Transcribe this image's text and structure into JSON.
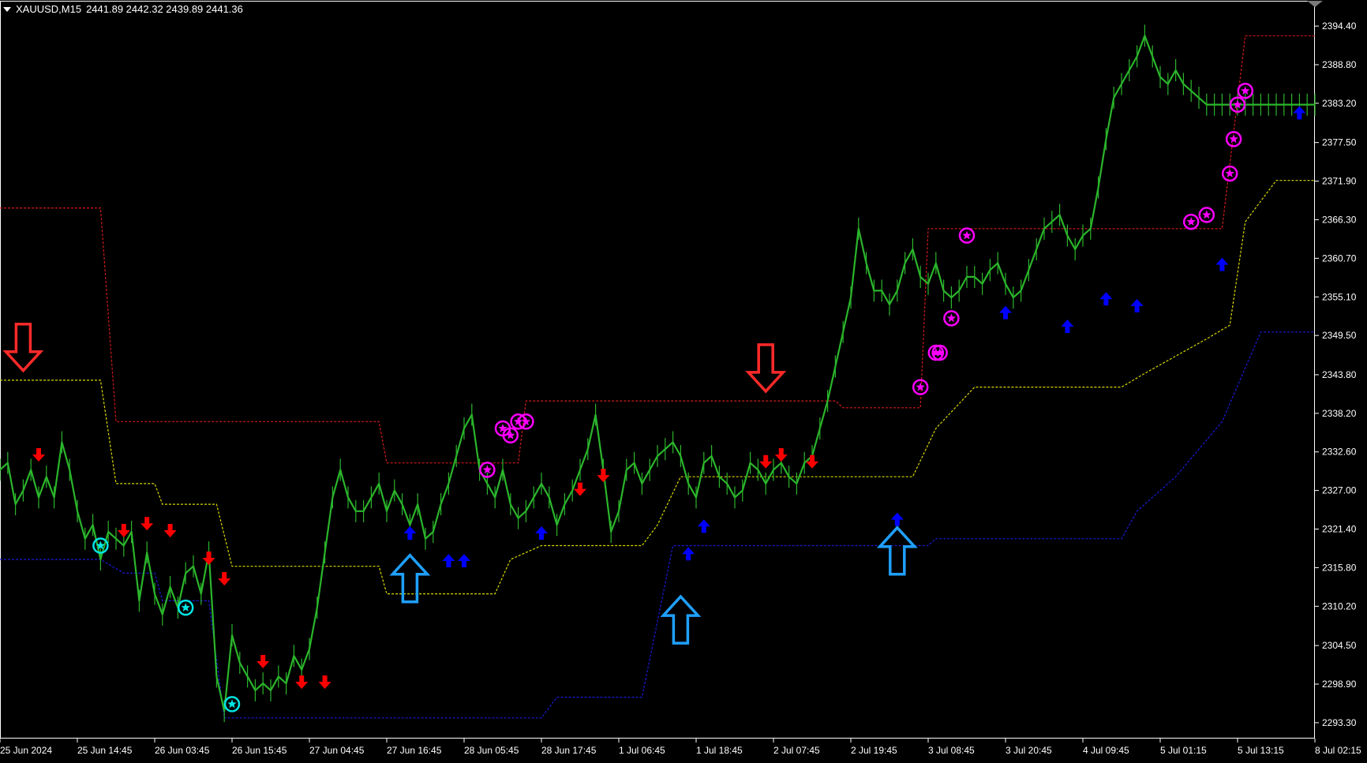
{
  "header": {
    "symbol": "XAUUSD,M15",
    "ohlc": "2441.89 2442.32 2439.89 2441.36"
  },
  "colors": {
    "background": "#000000",
    "price": "#2bb52b",
    "resistance": "#d21a1a",
    "middle": "#d8d800",
    "support": "#1a1ad8",
    "sell_arrow": "#ff0000",
    "buy_arrow": "#0000ff",
    "star_sell": "#ff00ff",
    "star_buy": "#00e5e5",
    "big_sell_outline": "#ff2a2a",
    "big_buy_outline": "#1fa0ff",
    "axis_text": "#ffffff",
    "frame": "#ffffff"
  },
  "chart_data": {
    "type": "line",
    "instrument": "XAUUSD",
    "timeframe": "M15",
    "ylim": [
      2291.0,
      2397.5
    ],
    "y_ticks": [
      2394.4,
      2388.8,
      2383.2,
      2377.5,
      2371.9,
      2366.3,
      2360.7,
      2355.1,
      2349.5,
      2343.8,
      2338.2,
      2332.6,
      2327.0,
      2321.4,
      2315.8,
      2310.2,
      2304.5,
      2298.9,
      2293.3
    ],
    "y_tick_labels": [
      "2394.40",
      "2388.80",
      "2383.20",
      "2377.50",
      "2371.90",
      "2366.30",
      "2360.70",
      "2355.10",
      "2349.50",
      "2343.80",
      "2338.20",
      "2332.60",
      "2327.00",
      "2321.40",
      "2315.80",
      "2310.20",
      "2304.50",
      "2298.90",
      "2293.30"
    ],
    "x_tick_labels": [
      "25 Jun 2024",
      "25 Jun 14:45",
      "26 Jun 03:45",
      "26 Jun 15:45",
      "27 Jun 04:45",
      "27 Jun 16:45",
      "28 Jun 05:45",
      "28 Jun 17:45",
      "1 Jul 06:45",
      "1 Jul 18:45",
      "2 Jul 07:45",
      "2 Jul 19:45",
      "3 Jul 08:45",
      "3 Jul 20:45",
      "4 Jul 09:45",
      "5 Jul 01:15",
      "5 Jul 13:15",
      "8 Jul 02:15"
    ],
    "xlim": [
      0,
      170
    ],
    "x_tick_positions": [
      0,
      10,
      20,
      30,
      40,
      50,
      60,
      70,
      80,
      90,
      100,
      110,
      120,
      130,
      140,
      150,
      160,
      170
    ],
    "price_series": {
      "x": [
        0,
        1,
        2,
        3,
        4,
        5,
        6,
        7,
        8,
        9,
        10,
        11,
        12,
        13,
        14,
        15,
        16,
        17,
        18,
        19,
        20,
        21,
        22,
        23,
        24,
        25,
        26,
        27,
        28,
        29,
        30,
        31,
        32,
        33,
        34,
        35,
        36,
        37,
        38,
        39,
        40,
        41,
        42,
        43,
        44,
        45,
        46,
        47,
        48,
        49,
        50,
        51,
        52,
        53,
        54,
        55,
        56,
        57,
        58,
        59,
        60,
        61,
        62,
        63,
        64,
        65,
        66,
        67,
        68,
        69,
        70,
        71,
        72,
        73,
        74,
        75,
        76,
        77,
        78,
        79,
        80,
        81,
        82,
        83,
        84,
        85,
        86,
        87,
        88,
        89,
        90,
        91,
        92,
        93,
        94,
        95,
        96,
        97,
        98,
        99,
        100,
        101,
        102,
        103,
        104,
        105,
        106,
        107,
        108,
        109,
        110,
        111,
        112,
        113,
        114,
        115,
        116,
        117,
        118,
        119,
        120,
        121,
        122,
        123,
        124,
        125,
        126,
        127,
        128,
        129,
        130,
        131,
        132,
        133,
        134,
        135,
        136,
        137,
        138,
        139,
        140,
        141,
        142,
        143,
        144,
        145,
        146,
        147,
        148,
        149,
        150,
        151,
        152,
        153,
        154,
        155,
        156,
        157,
        158,
        159,
        160,
        161,
        162,
        163,
        164,
        165,
        166,
        167,
        168,
        169,
        170
      ],
      "y": [
        2330,
        2331,
        2325,
        2327,
        2330,
        2326,
        2329,
        2326,
        2334,
        2330,
        2324,
        2320,
        2322,
        2317,
        2321,
        2320,
        2319,
        2321,
        2311,
        2318,
        2312,
        2309,
        2313,
        2310,
        2315,
        2316,
        2312,
        2318,
        2300,
        2295,
        2306,
        2302,
        2300,
        2298,
        2299,
        2298,
        2300,
        2299,
        2303,
        2301,
        2304,
        2310,
        2318,
        2326,
        2330,
        2326,
        2324,
        2324,
        2326,
        2328,
        2324,
        2327,
        2325,
        2322,
        2325,
        2320,
        2321,
        2325,
        2328,
        2332,
        2336,
        2338,
        2330,
        2328,
        2326,
        2330,
        2325,
        2323,
        2324,
        2326,
        2328,
        2326,
        2322,
        2325,
        2327,
        2330,
        2333,
        2338,
        2330,
        2321,
        2324,
        2330,
        2331,
        2328,
        2330,
        2332,
        2333,
        2334,
        2332,
        2328,
        2326,
        2331,
        2332,
        2329,
        2328,
        2326,
        2327,
        2331,
        2330,
        2328,
        2330,
        2331,
        2329,
        2328,
        2331,
        2332,
        2336,
        2340,
        2345,
        2350,
        2355,
        2365,
        2360,
        2356,
        2356,
        2354,
        2356,
        2360,
        2362,
        2358,
        2357,
        2360,
        2356,
        2355,
        2356,
        2358,
        2358,
        2357,
        2359,
        2360,
        2357,
        2355,
        2356,
        2359,
        2362,
        2365,
        2366,
        2367,
        2364,
        2362,
        2364,
        2365,
        2371,
        2378,
        2384,
        2386,
        2388,
        2390,
        2393,
        2390,
        2387,
        2386,
        2388,
        2386,
        2385,
        2384,
        2383,
        2383,
        2383,
        2383,
        2383,
        2383,
        2383,
        2383,
        2383,
        2383,
        2383,
        2383,
        2383,
        2383,
        2383
      ]
    },
    "resistance_steps": [
      [
        0,
        2368
      ],
      [
        13,
        2368
      ],
      [
        15,
        2337
      ],
      [
        49,
        2337
      ],
      [
        50,
        2331
      ],
      [
        67,
        2331
      ],
      [
        68,
        2340
      ],
      [
        108,
        2340
      ],
      [
        109,
        2339
      ],
      [
        119,
        2339
      ],
      [
        120,
        2365
      ],
      [
        158,
        2365
      ],
      [
        161,
        2393
      ],
      [
        170,
        2393
      ]
    ],
    "middle_steps": [
      [
        0,
        2343
      ],
      [
        13,
        2343
      ],
      [
        15,
        2328
      ],
      [
        20,
        2328
      ],
      [
        21,
        2325
      ],
      [
        28,
        2325
      ],
      [
        30,
        2316
      ],
      [
        49,
        2316
      ],
      [
        50,
        2312
      ],
      [
        64,
        2312
      ],
      [
        66,
        2317
      ],
      [
        70,
        2319
      ],
      [
        83,
        2319
      ],
      [
        85,
        2322
      ],
      [
        88,
        2329
      ],
      [
        118,
        2329
      ],
      [
        121,
        2336
      ],
      [
        126,
        2342
      ],
      [
        145,
        2342
      ],
      [
        148,
        2344
      ],
      [
        156,
        2349
      ],
      [
        159,
        2351
      ],
      [
        161,
        2366
      ],
      [
        165,
        2372
      ],
      [
        170,
        2372
      ]
    ],
    "support_steps": [
      [
        0,
        2317
      ],
      [
        13,
        2317
      ],
      [
        16,
        2315
      ],
      [
        20,
        2315
      ],
      [
        21,
        2311
      ],
      [
        27,
        2311
      ],
      [
        29,
        2294
      ],
      [
        70,
        2294
      ],
      [
        72,
        2297
      ],
      [
        83,
        2297
      ],
      [
        87,
        2319
      ],
      [
        120,
        2319
      ],
      [
        121,
        2320
      ],
      [
        145,
        2320
      ],
      [
        147,
        2324
      ],
      [
        152,
        2329
      ],
      [
        158,
        2337
      ],
      [
        163,
        2350
      ],
      [
        170,
        2350
      ]
    ],
    "sell_arrows": [
      [
        5,
        2332
      ],
      [
        16,
        2321
      ],
      [
        19,
        2322
      ],
      [
        22,
        2321
      ],
      [
        27,
        2317
      ],
      [
        29,
        2314
      ],
      [
        34,
        2302
      ],
      [
        39,
        2299
      ],
      [
        42,
        2299
      ],
      [
        75,
        2327
      ],
      [
        78,
        2329
      ],
      [
        99,
        2331
      ],
      [
        101,
        2332
      ],
      [
        105,
        2331
      ]
    ],
    "buy_arrows": [
      [
        53,
        2321
      ],
      [
        58,
        2317
      ],
      [
        60,
        2317
      ],
      [
        70,
        2321
      ],
      [
        89,
        2318
      ],
      [
        91,
        2322
      ],
      [
        116,
        2323
      ],
      [
        130,
        2353
      ],
      [
        138,
        2351
      ],
      [
        143,
        2355
      ],
      [
        147,
        2354
      ],
      [
        158,
        2360
      ],
      [
        168,
        2382
      ]
    ],
    "sell_stars": [
      [
        63,
        2330
      ],
      [
        65,
        2336
      ],
      [
        66,
        2335
      ],
      [
        67,
        2337
      ],
      [
        68,
        2337
      ],
      [
        119,
        2342
      ],
      [
        121,
        2347
      ],
      [
        121.5,
        2347
      ],
      [
        123,
        2352
      ],
      [
        125,
        2364
      ],
      [
        154,
        2366
      ],
      [
        156,
        2367
      ],
      [
        159,
        2373
      ],
      [
        159.5,
        2378
      ],
      [
        160,
        2383
      ],
      [
        161,
        2385
      ]
    ],
    "buy_stars": [
      [
        13,
        2319
      ],
      [
        24,
        2310
      ],
      [
        30,
        2296
      ]
    ],
    "big_sell_arrows": [
      [
        3,
        2346
      ],
      [
        99,
        2343
      ]
    ],
    "big_buy_arrows": [
      [
        53,
        2316
      ],
      [
        88,
        2310
      ],
      [
        116,
        2320
      ]
    ]
  }
}
